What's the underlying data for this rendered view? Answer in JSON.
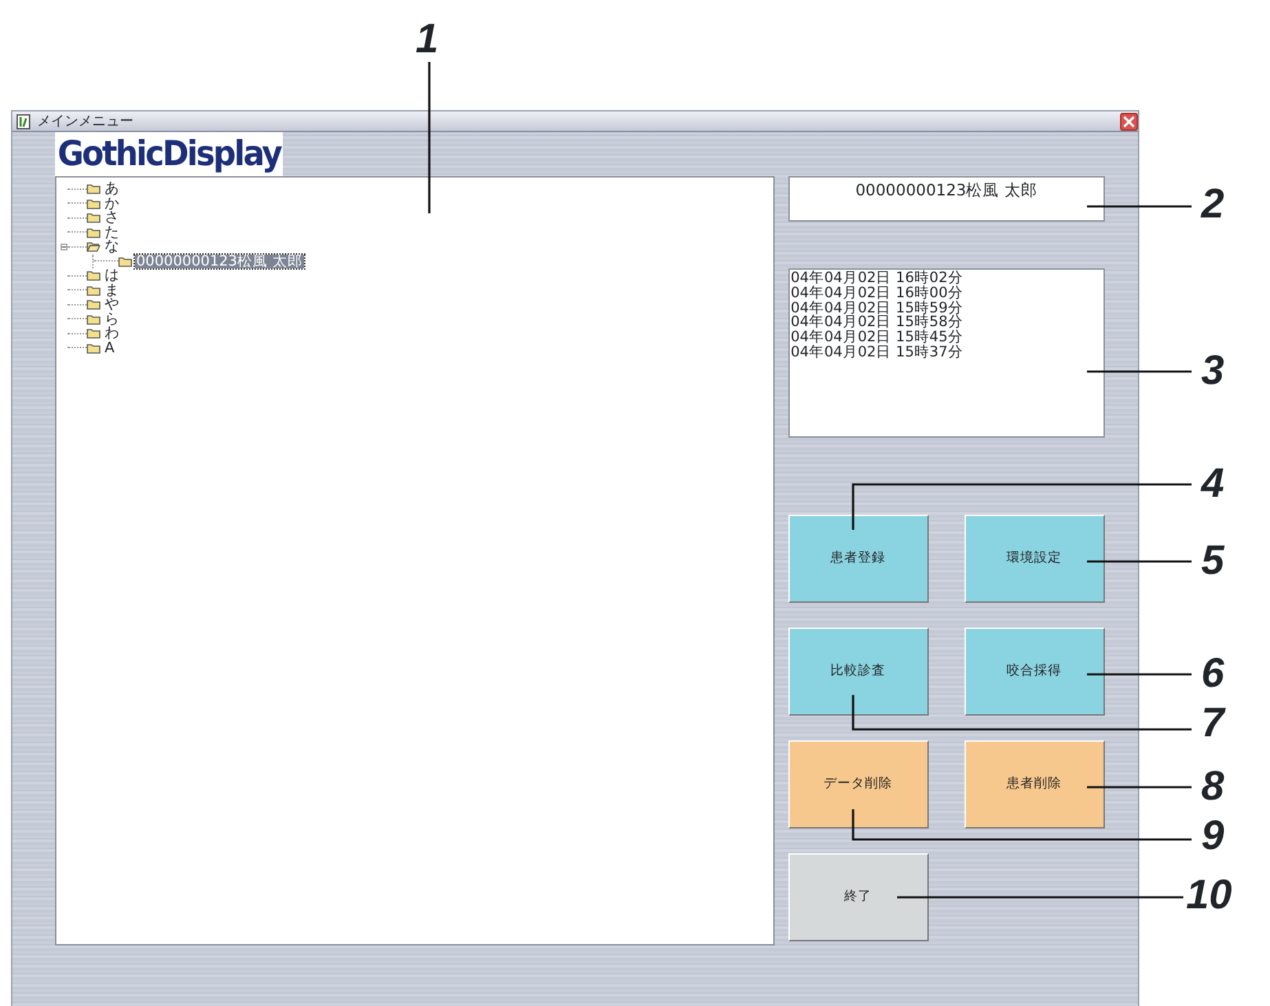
{
  "window": {
    "title": "メインメニュー"
  },
  "logo": "GothicDisplay",
  "tree": [
    {
      "label": "あ",
      "expanded": false,
      "selected": false
    },
    {
      "label": "か",
      "expanded": false,
      "selected": false
    },
    {
      "label": "さ",
      "expanded": false,
      "selected": false
    },
    {
      "label": "た",
      "expanded": false,
      "selected": false
    },
    {
      "label": "な",
      "expanded": true,
      "selected": false,
      "children": [
        {
          "label": "00000000123松風  太郎",
          "expanded": false,
          "selected": true
        }
      ]
    },
    {
      "label": "は",
      "expanded": false,
      "selected": false
    },
    {
      "label": "ま",
      "expanded": false,
      "selected": false
    },
    {
      "label": "や",
      "expanded": false,
      "selected": false
    },
    {
      "label": "ら",
      "expanded": false,
      "selected": false
    },
    {
      "label": "わ",
      "expanded": false,
      "selected": false
    },
    {
      "label": "A",
      "expanded": false,
      "selected": false
    }
  ],
  "patient_name": "00000000123松風  太郎",
  "records": [
    "04年04月02日  16時02分",
    "04年04月02日  16時00分",
    "04年04月02日  15時59分",
    "04年04月02日  15時58分",
    "04年04月02日  15時45分",
    "04年04月02日  15時37分"
  ],
  "buttons": [
    {
      "label": "患者登録",
      "color": "#8ad3e0"
    },
    {
      "label": "環境設定",
      "color": "#8ad3e0"
    },
    {
      "label": "比較診査",
      "color": "#8ad3e0"
    },
    {
      "label": "咬合採得",
      "color": "#8ad3e0"
    },
    {
      "label": "データ削除",
      "color": "#f7c88d"
    },
    {
      "label": "患者削除",
      "color": "#f7c88d"
    },
    {
      "label": "終了",
      "color": "#d6d9da"
    }
  ],
  "callouts": [
    "1",
    "2",
    "3",
    "4",
    "5",
    "6",
    "7",
    "8",
    "9",
    "10"
  ]
}
